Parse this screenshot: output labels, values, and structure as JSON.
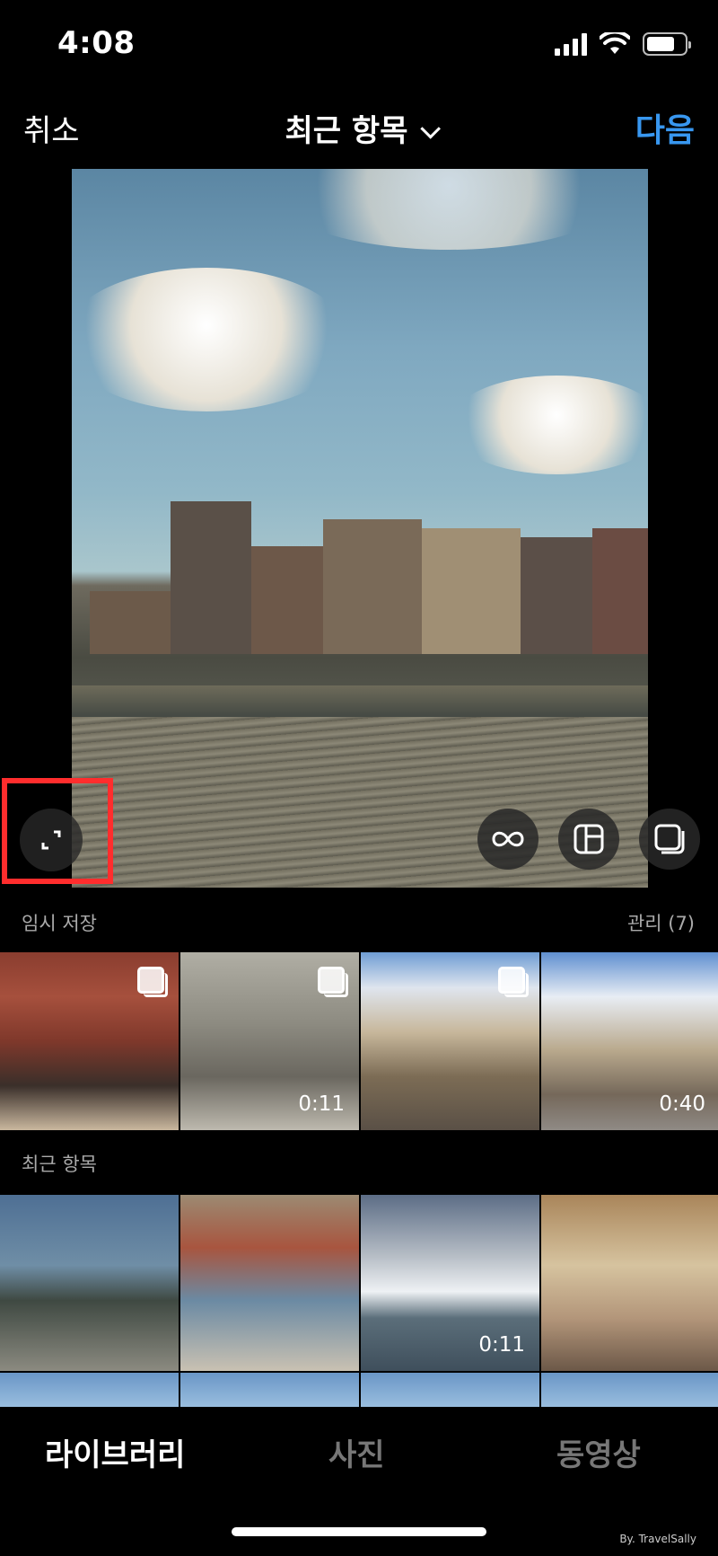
{
  "status": {
    "time": "4:08",
    "battery_level": 0.75
  },
  "header": {
    "cancel_label": "취소",
    "album_title": "최근 항목",
    "next_label": "다음"
  },
  "drafts": {
    "label": "임시 저장",
    "manage_label": "관리 (7)"
  },
  "draft_items": [
    {
      "duration": "",
      "multi_select": true
    },
    {
      "duration": "0:11",
      "multi_select": true
    },
    {
      "duration": "",
      "multi_select": true
    },
    {
      "duration": "0:40",
      "multi_select": false
    }
  ],
  "recent": {
    "label": "최근 항목"
  },
  "recent_items": [
    {
      "duration": ""
    },
    {
      "duration": ""
    },
    {
      "duration": "0:11"
    },
    {
      "duration": ""
    }
  ],
  "tabs": {
    "library": "라이브러리",
    "photo": "사진",
    "video": "동영상"
  },
  "watermark": "By. TravelSally",
  "colors": {
    "accent": "#3897f0",
    "highlight": "#ff2d2d"
  }
}
